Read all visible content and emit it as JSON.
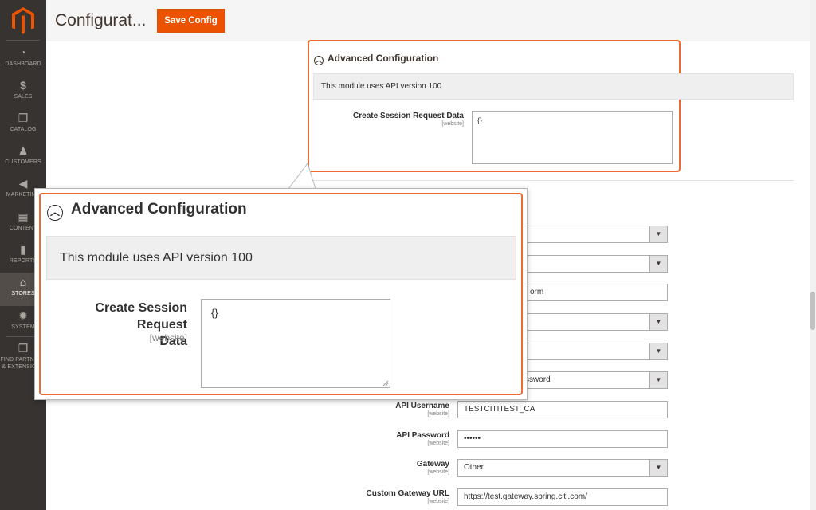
{
  "sidebar": {
    "items": [
      {
        "label": "DASHBOARD",
        "icon": "dashboard-icon",
        "glyph": "◔"
      },
      {
        "label": "SALES",
        "icon": "dollar-icon",
        "glyph": "$"
      },
      {
        "label": "CATALOG",
        "icon": "cube-icon",
        "glyph": "❒"
      },
      {
        "label": "CUSTOMERS",
        "icon": "person-icon",
        "glyph": "♟"
      },
      {
        "label": "MARKETING",
        "icon": "megaphone-icon",
        "glyph": "◀"
      },
      {
        "label": "CONTENT",
        "icon": "layout-icon",
        "glyph": "▦"
      },
      {
        "label": "REPORTS",
        "icon": "bar-chart-icon",
        "glyph": "▮"
      },
      {
        "label": "STORES",
        "icon": "storefront-icon",
        "glyph": "⌂"
      },
      {
        "label": "SYSTEM",
        "icon": "gear-icon",
        "glyph": "✹"
      },
      {
        "label": "FIND PARTNERS",
        "icon": "box-icon",
        "glyph": "❒"
      },
      {
        "label": "& EXTENSIONS",
        "icon": "",
        "glyph": ""
      }
    ]
  },
  "header": {
    "title": "Configurat...",
    "save_label": "Save Config"
  },
  "section": {
    "title": "Advanced Configuration",
    "notice": "This module uses API version 100",
    "session_label": "Create Session Request Data",
    "session_label_line1": "Create Session Request",
    "session_label_line2": "Data",
    "scope": "[website]",
    "session_value": "{}"
  },
  "form": {
    "partial_1": "orm",
    "partial_2": "ssword",
    "api_username_label": "API Username",
    "api_username_value": "TESTCITITEST_CA",
    "api_password_label": "API Password",
    "api_password_value": "••••••",
    "gateway_label": "Gateway",
    "gateway_value": "Other",
    "custom_gateway_label": "Custom Gateway URL",
    "custom_gateway_value": "https://test.gateway.spring.citi.com/",
    "scope": "[website]"
  },
  "colors": {
    "accent": "#eb5202",
    "highlight": "#eb6b35",
    "sidebar": "#373330"
  }
}
